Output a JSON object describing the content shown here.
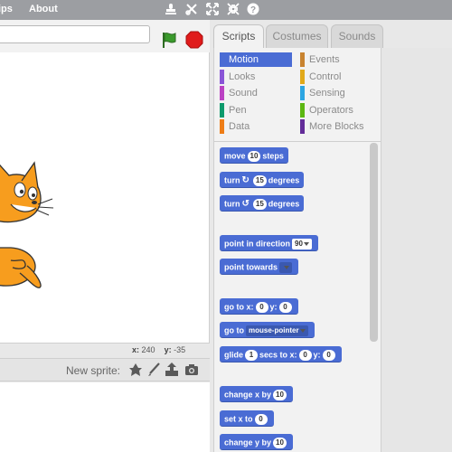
{
  "menubar": {
    "menu_left": "ips",
    "about": "About",
    "icons": [
      "duplicate-stamp-icon",
      "cut-scissors-icon",
      "grow-icon",
      "shrink-icon",
      "help-icon"
    ]
  },
  "stage": {
    "coords": {
      "x_label": "x:",
      "x_value": "240",
      "y_label": "y:",
      "y_value": "-35"
    }
  },
  "sprite_pane": {
    "new_sprite_label": "New sprite:",
    "icons": [
      "choose-sprite-library-icon",
      "paint-brush-icon",
      "upload-sprite-icon",
      "camera-icon"
    ]
  },
  "tabs": [
    {
      "label": "Scripts",
      "active": true
    },
    {
      "label": "Costumes",
      "active": false
    },
    {
      "label": "Sounds",
      "active": false
    }
  ],
  "categories": [
    {
      "label": "Motion",
      "color": "#4a6cd4",
      "selected": true
    },
    {
      "label": "Events",
      "color": "#c88330"
    },
    {
      "label": "Looks",
      "color": "#8a55d7"
    },
    {
      "label": "Control",
      "color": "#e1a91a"
    },
    {
      "label": "Sound",
      "color": "#bb42c3"
    },
    {
      "label": "Sensing",
      "color": "#2ca5e2"
    },
    {
      "label": "Pen",
      "color": "#0e9a6c"
    },
    {
      "label": "Operators",
      "color": "#5cb712"
    },
    {
      "label": "Data",
      "color": "#ee7d16"
    },
    {
      "label": "More Blocks",
      "color": "#632d99"
    }
  ],
  "blocks": {
    "move": {
      "a": "move",
      "n": "10",
      "b": "steps"
    },
    "turn_right": {
      "a": "turn",
      "n": "15",
      "b": "degrees"
    },
    "turn_left": {
      "a": "turn",
      "n": "15",
      "b": "degrees"
    },
    "point_direction": {
      "a": "point in direction",
      "n": "90"
    },
    "point_towards": {
      "a": "point towards",
      "n": ""
    },
    "go_to_xy": {
      "a": "go to x:",
      "x": "0",
      "b": "y:",
      "y": "0"
    },
    "go_to": {
      "a": "go to",
      "n": "mouse-pointer"
    },
    "glide": {
      "a": "glide",
      "n": "1",
      "b": "secs to x:",
      "x": "0",
      "c": "y:",
      "y": "0"
    },
    "change_x": {
      "a": "change x by",
      "n": "10"
    },
    "set_x": {
      "a": "set x to",
      "n": "0"
    },
    "change_y": {
      "a": "change y by",
      "n": "10"
    }
  },
  "colors": {
    "motion": "#4a6cd4",
    "green_flag": "#3a9a2c",
    "stop": "#e01b1b",
    "cat_orange": "#f79d1e"
  }
}
